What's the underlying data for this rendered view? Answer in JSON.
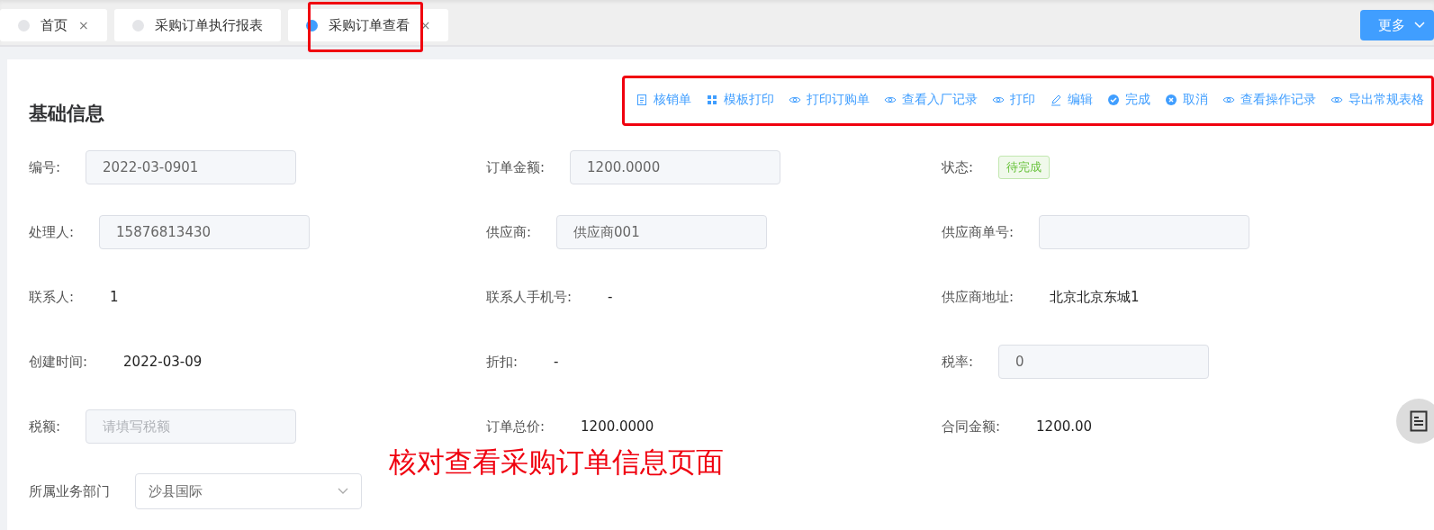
{
  "tabs": [
    {
      "label": "首页",
      "selected": false,
      "close": "×",
      "annotated": false
    },
    {
      "label": "采购订单执行报表",
      "selected": false,
      "annotated": false
    },
    {
      "label": "采购订单查看",
      "selected": true,
      "close": "×",
      "annotated": true
    }
  ],
  "more_button": {
    "label": "更多"
  },
  "section_title": "基础信息",
  "actions": [
    {
      "kind": "document",
      "label": "核销单"
    },
    {
      "kind": "grid",
      "label": "模板打印"
    },
    {
      "kind": "eye",
      "label": "打印订购单"
    },
    {
      "kind": "eye",
      "label": "查看入厂记录"
    },
    {
      "kind": "eye",
      "label": "打印"
    },
    {
      "kind": "pen",
      "label": "编辑"
    },
    {
      "kind": "check",
      "label": "完成"
    },
    {
      "kind": "cancel",
      "label": "取消"
    },
    {
      "kind": "eye",
      "label": "查看操作记录"
    },
    {
      "kind": "eye",
      "label": "导出常规表格"
    }
  ],
  "fields": [
    {
      "label": "编号:",
      "kind": "input",
      "value": "2022-03-0901"
    },
    {
      "label": "订单金额:",
      "kind": "input",
      "value": "1200.0000"
    },
    {
      "label": "状态:",
      "kind": "tag",
      "value": "待完成"
    },
    {
      "label": "处理人:",
      "kind": "input",
      "value": "15876813430"
    },
    {
      "label": "供应商:",
      "kind": "input",
      "value": "供应商001"
    },
    {
      "label": "供应商单号:",
      "kind": "input"
    },
    {
      "label": "联系人:",
      "kind": "text",
      "value": "1"
    },
    {
      "label": "联系人手机号:",
      "kind": "text",
      "value": "-"
    },
    {
      "label": "供应商地址:",
      "kind": "text",
      "value": "北京北京东城1"
    },
    {
      "label": "创建时间:",
      "kind": "text",
      "value": "2022-03-09"
    },
    {
      "label": "折扣:",
      "kind": "text",
      "value": "-"
    },
    {
      "label": "税率:",
      "kind": "input",
      "value": "0"
    },
    {
      "label": "税额:",
      "kind": "input",
      "placeholder": "请填写税额"
    },
    {
      "label": "订单总价:",
      "kind": "text",
      "value": "1200.0000"
    },
    {
      "label": "合同金额:",
      "kind": "text",
      "value": "1200.00"
    },
    {
      "label": "所属业务部门",
      "kind": "select",
      "value": "沙县国际"
    }
  ],
  "annotation": "核对查看采购订单信息页面"
}
